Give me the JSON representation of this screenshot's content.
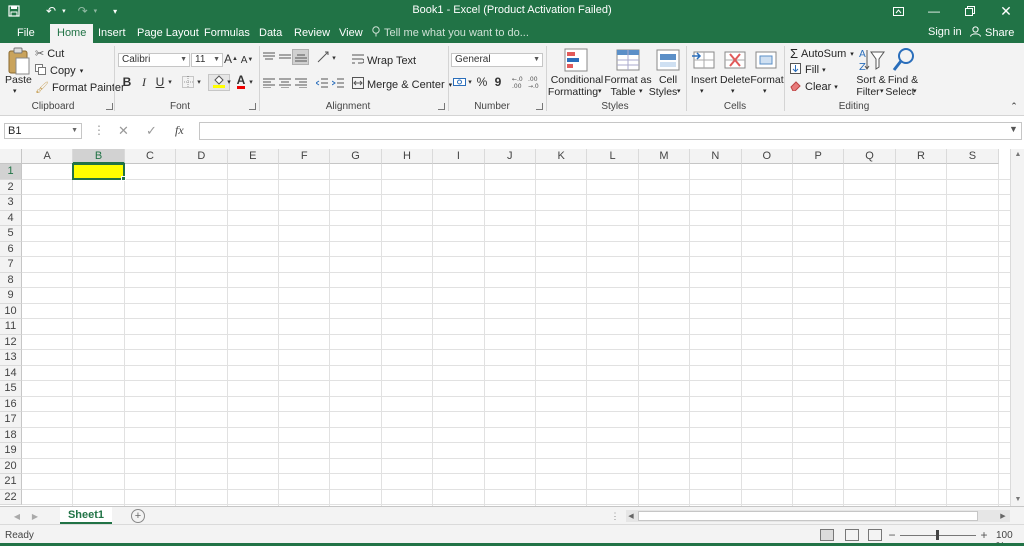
{
  "window": {
    "title": "Book1 - Excel (Product Activation Failed)"
  },
  "ribbon_tabs": [
    {
      "label": "File"
    },
    {
      "label": "Home"
    },
    {
      "label": "Insert"
    },
    {
      "label": "Page Layout"
    },
    {
      "label": "Formulas"
    },
    {
      "label": "Data"
    },
    {
      "label": "Review"
    },
    {
      "label": "View"
    }
  ],
  "tellme_placeholder": "Tell me what you want to do...",
  "account": {
    "signin": "Sign in",
    "share": "Share"
  },
  "clipboard": {
    "paste": "Paste",
    "cut": "Cut",
    "copy": "Copy",
    "format_painter": "Format Painter",
    "label": "Clipboard"
  },
  "font": {
    "name": "Calibri",
    "size": "11",
    "bold": "B",
    "italic": "I",
    "underline": "U",
    "label": "Font"
  },
  "alignment": {
    "wrap_text": "Wrap Text",
    "merge_center": "Merge & Center",
    "label": "Alignment"
  },
  "number": {
    "format": "General",
    "percent": "%",
    "comma": "9",
    "label": "Number"
  },
  "styles": {
    "conditional_1": "Conditional",
    "conditional_2": "Formatting",
    "format_table_1": "Format as",
    "format_table_2": "Table",
    "cell_styles_1": "Cell",
    "cell_styles_2": "Styles",
    "label": "Styles"
  },
  "cells": {
    "insert": "Insert",
    "delete": "Delete",
    "format": "Format",
    "label": "Cells"
  },
  "editing": {
    "autosum": "AutoSum",
    "fill": "Fill",
    "clear": "Clear",
    "sort_1": "Sort &",
    "sort_2": "Filter",
    "find_1": "Find &",
    "find_2": "Select",
    "label": "Editing"
  },
  "formula_bar": {
    "name_box": "B1",
    "fx": "fx",
    "value": ""
  },
  "columns": [
    "A",
    "B",
    "C",
    "D",
    "E",
    "F",
    "G",
    "H",
    "I",
    "J",
    "K",
    "L",
    "M",
    "N",
    "O",
    "P",
    "Q",
    "R",
    "S"
  ],
  "rows": [
    "1",
    "2",
    "3",
    "4",
    "5",
    "6",
    "7",
    "8",
    "9",
    "10",
    "11",
    "12",
    "13",
    "14",
    "15",
    "16",
    "17",
    "18",
    "19",
    "20",
    "21",
    "22"
  ],
  "selected_cell": {
    "column": "B",
    "row": "1",
    "fill": "#ffff00"
  },
  "sheets": [
    {
      "name": "Sheet1"
    }
  ],
  "status": {
    "ready": "Ready",
    "zoom": "100 %"
  },
  "colors": {
    "accent": "#217346",
    "ribbon_bg": "#f3f3f3"
  }
}
